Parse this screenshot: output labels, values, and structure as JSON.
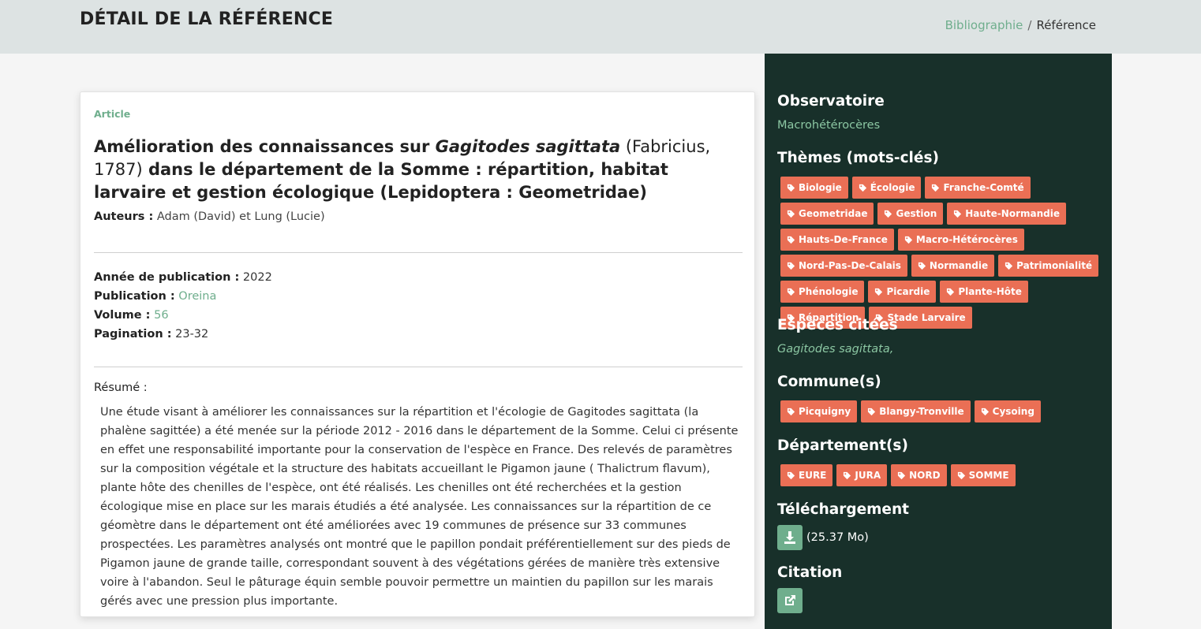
{
  "header": {
    "title": "DÉTAIL DE LA RÉFÉRENCE",
    "breadcrumb": [
      "Bibliographie",
      "Référence"
    ]
  },
  "reference": {
    "type": "Article",
    "title_part1": "Amélioration des connaissances sur ",
    "title_species": "Gagitodes sagittata",
    "title_author_year": " (Fabricius, 1787)",
    "title_part2": " dans le département de la Somme : répartition, habitat larvaire et gestion écologique (Lepidoptera : Geometridae)",
    "authors_label": "Auteurs :",
    "authors": "Adam (David) et Lung (Lucie)",
    "year_label": "Année de publication :",
    "year": "2022",
    "publication_label": "Publication :",
    "publication": "Oreina",
    "volume_label": "Volume :",
    "volume": "56",
    "pagination_label": "Pagination :",
    "pagination": "23-32",
    "resume_label": "Résumé :",
    "resume": "Une étude visant à améliorer les connaissances sur la répartition et l'écologie de Gagitodes sagittata (la phalène sagittée) a été menée sur la période 2012 - 2016 dans le département de la Somme. Celui ci présente en effet une responsabilité importante pour la conservation de l'espèce en France. Des relevés de paramètres sur la composition végétale et la structure des habitats accueillant le Pigamon jaune ( Thalictrum flavum), plante hôte des chenilles de l'espèce, ont été réalisés. Les chenilles ont été recherchées et la gestion écologique mise en place sur les marais étudiés a été analysée. Les connaissances sur la répartition de ce géomètre dans le département ont été améliorées avec 19 communes de présence sur 33 communes prospectées. Les paramètres analysés ont montré que le papillon pondait préférentiellement sur des pieds  de Pigamon jaune de grande taille, correspondant souvent à des végétations gérées de manière très extensive voire à l'abandon. Seul le pâturage équin semble pouvoir permettre un maintien du papillon sur les marais gérés avec une pression plus importante."
  },
  "sidebar": {
    "observatoire_heading": "Observatoire",
    "observatoire": "Macrohétérocères",
    "themes_heading": "Thèmes (mots-clés)",
    "themes": [
      "Biologie",
      "Écologie",
      "Franche-Comté",
      "Geometridae",
      "Gestion",
      "Haute-Normandie",
      "Hauts-De-France",
      "Macro-Hétérocères",
      "Nord-Pas-De-Calais",
      "Normandie",
      "Patrimonialité",
      "Phénologie",
      "Picardie",
      "Plante-Hôte",
      "Répartition",
      "Stade Larvaire"
    ],
    "especes_heading": "Espèces citées",
    "especes": "Gagitodes sagittata,",
    "communes_heading": "Commune(s)",
    "communes": [
      "Picquigny",
      "Blangy-Tronville",
      "Cysoing"
    ],
    "departements_heading": "Département(s)",
    "departements": [
      "EURE",
      "JURA",
      "NORD",
      "SOMME"
    ],
    "telechargement_heading": "Téléchargement",
    "download_size": "(25.37 Mo)",
    "citation_heading": "Citation"
  },
  "colors": {
    "accent_green": "#6fae8d",
    "sidebar_bg": "#18302a",
    "tag_bg": "#ea6f55",
    "header_bg": "#dde3e3"
  },
  "icons": {
    "tag": "tag-icon",
    "download": "download-icon",
    "citation": "external-link-icon"
  }
}
